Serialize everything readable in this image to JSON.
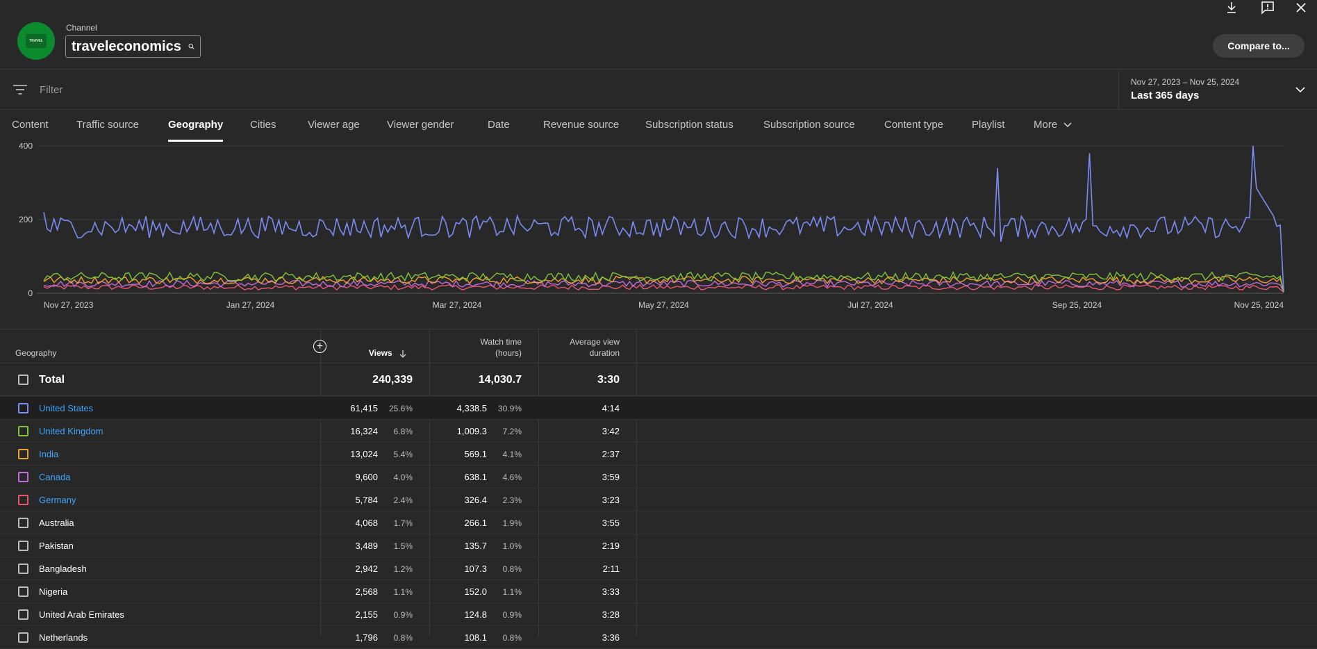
{
  "header": {
    "channel_label": "Channel",
    "channel_name": "traveleconomics",
    "avatar_text": "TRAVEL",
    "compare_label": "Compare to...",
    "icons": [
      "download-icon",
      "feedback-icon",
      "close-icon"
    ]
  },
  "filter": {
    "placeholder": "Filter",
    "date_range": "Nov 27, 2023 – Nov 25, 2024",
    "date_preset": "Last 365 days"
  },
  "tabs": [
    {
      "label": "Content"
    },
    {
      "label": "Traffic source"
    },
    {
      "label": "Geography",
      "active": true
    },
    {
      "label": "Cities"
    },
    {
      "label": "Viewer age"
    },
    {
      "label": "Viewer gender"
    },
    {
      "label": "Date"
    },
    {
      "label": "Revenue source"
    },
    {
      "label": "Subscription status"
    },
    {
      "label": "Subscription source"
    },
    {
      "label": "Content type"
    },
    {
      "label": "Playlist"
    },
    {
      "label": "More"
    }
  ],
  "chart_data": {
    "type": "line",
    "y_ticks": [
      "400",
      "200",
      "0"
    ],
    "ylim": [
      0,
      400
    ],
    "x_ticks": [
      "Nov 27, 2023",
      "Jan 27, 2024",
      "Mar 27, 2024",
      "May 27, 2024",
      "Jul 27, 2024",
      "Sep 25, 2024",
      "Nov 25, 2024"
    ],
    "grid": true,
    "series": [
      {
        "name": "United States",
        "color": "#7b8cf4",
        "base": 180,
        "noise": 30
      },
      {
        "name": "United Kingdom",
        "color": "#7fc63a",
        "base": 45,
        "noise": 12
      },
      {
        "name": "India",
        "color": "#f0a030",
        "base": 36,
        "noise": 10
      },
      {
        "name": "Canada",
        "color": "#c26be0",
        "base": 26,
        "noise": 9
      },
      {
        "name": "Germany",
        "color": "#e9576f",
        "base": 16,
        "noise": 7
      }
    ]
  },
  "table": {
    "headers": {
      "geography": "Geography",
      "views": "Views",
      "watch_time_1": "Watch time",
      "watch_time_2": "(hours)",
      "avd_1": "Average view",
      "avd_2": "duration"
    },
    "total": {
      "label": "Total",
      "views": "240,339",
      "watch": "14,030.7",
      "avd": "3:30"
    },
    "rows": [
      {
        "name": "United States",
        "views": "61,415",
        "views_pct": "25.6%",
        "watch": "4,338.5",
        "watch_pct": "30.9%",
        "avd": "4:14",
        "color": "#7b8cf4",
        "link": true
      },
      {
        "name": "United Kingdom",
        "views": "16,324",
        "views_pct": "6.8%",
        "watch": "1,009.3",
        "watch_pct": "7.2%",
        "avd": "3:42",
        "color": "#7fc63a",
        "link": true
      },
      {
        "name": "India",
        "views": "13,024",
        "views_pct": "5.4%",
        "watch": "569.1",
        "watch_pct": "4.1%",
        "avd": "2:37",
        "color": "#f0a030",
        "link": true
      },
      {
        "name": "Canada",
        "views": "9,600",
        "views_pct": "4.0%",
        "watch": "638.1",
        "watch_pct": "4.6%",
        "avd": "3:59",
        "color": "#c26be0",
        "link": true
      },
      {
        "name": "Germany",
        "views": "5,784",
        "views_pct": "2.4%",
        "watch": "326.4",
        "watch_pct": "2.3%",
        "avd": "3:23",
        "color": "#e9576f",
        "link": true
      },
      {
        "name": "Australia",
        "views": "4,068",
        "views_pct": "1.7%",
        "watch": "266.1",
        "watch_pct": "1.9%",
        "avd": "3:55",
        "color": "",
        "link": false
      },
      {
        "name": "Pakistan",
        "views": "3,489",
        "views_pct": "1.5%",
        "watch": "135.7",
        "watch_pct": "1.0%",
        "avd": "2:19",
        "color": "",
        "link": false
      },
      {
        "name": "Bangladesh",
        "views": "2,942",
        "views_pct": "1.2%",
        "watch": "107.3",
        "watch_pct": "0.8%",
        "avd": "2:11",
        "color": "",
        "link": false
      },
      {
        "name": "Nigeria",
        "views": "2,568",
        "views_pct": "1.1%",
        "watch": "152.0",
        "watch_pct": "1.1%",
        "avd": "3:33",
        "color": "",
        "link": false
      },
      {
        "name": "United Arab Emirates",
        "views": "2,155",
        "views_pct": "0.9%",
        "watch": "124.8",
        "watch_pct": "0.9%",
        "avd": "3:28",
        "color": "",
        "link": false
      },
      {
        "name": "Netherlands",
        "views": "1,796",
        "views_pct": "0.8%",
        "watch": "108.1",
        "watch_pct": "0.8%",
        "avd": "3:36",
        "color": "",
        "link": false
      }
    ]
  }
}
